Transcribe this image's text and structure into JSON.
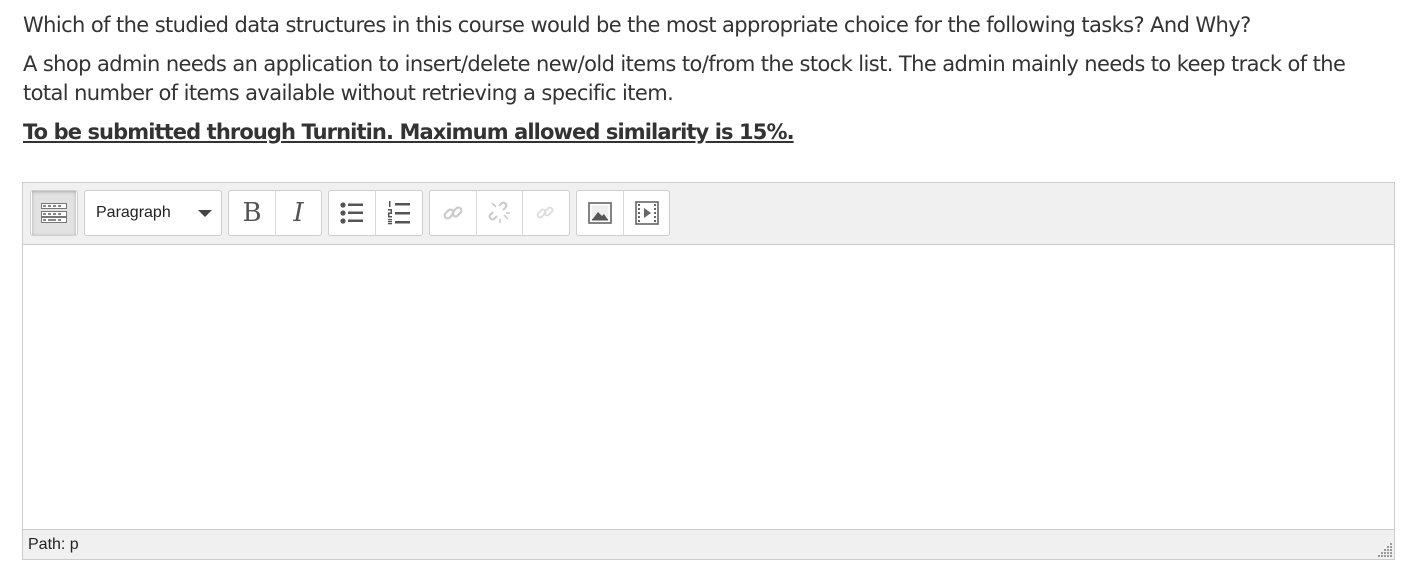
{
  "question": {
    "line1": "Which of the studied data structures in this course would be the most appropriate choice for the following tasks? And Why?",
    "line2": "A shop admin needs an application to insert/delete new/old items to/from the stock list. The admin mainly needs to keep track of the total number of items available without retrieving a specific item.",
    "line3": "To be submitted through Turnitin. Maximum allowed similarity is 15%."
  },
  "toolbar": {
    "kitchen_sink_icon": "toolbar-toggle-icon",
    "format_select": {
      "selected": "Paragraph"
    },
    "bold_label": "B",
    "italic_label": "I",
    "icons": [
      "unordered-list-icon",
      "ordered-list-icon",
      "link-icon",
      "unlink-icon",
      "anchor-icon",
      "image-icon",
      "media-icon"
    ]
  },
  "editor": {
    "content": ""
  },
  "statusbar": {
    "path_label": "Path: p"
  },
  "colors": {
    "text": "#333333",
    "toolbar_bg": "#f0f0f0",
    "border": "#cccccc",
    "icon": "#555555",
    "icon_disabled": "#c8c8c8"
  }
}
